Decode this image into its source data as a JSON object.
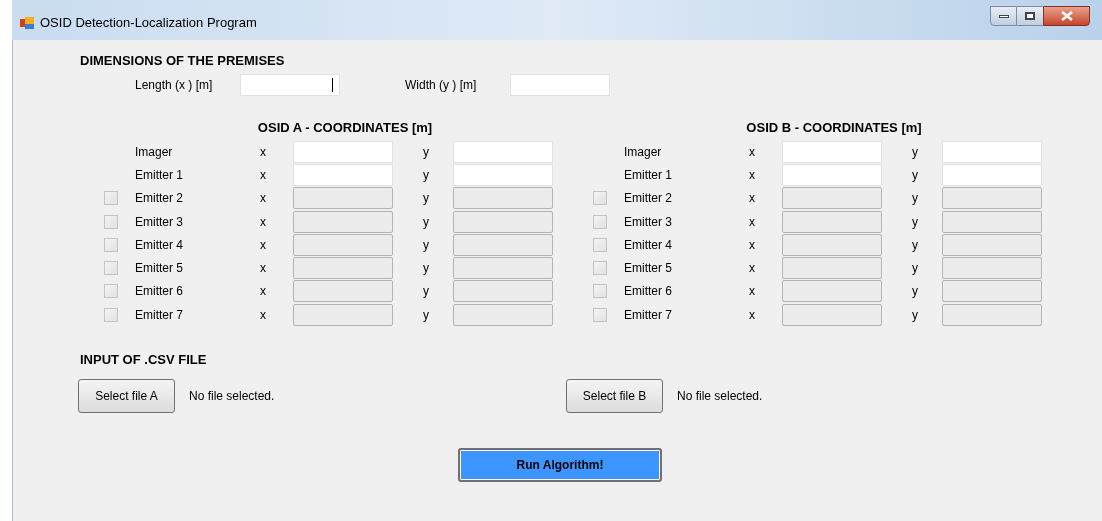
{
  "window": {
    "title": "OSID Detection-Localization Program"
  },
  "dimensions": {
    "heading": "DIMENSIONS OF THE PREMISES",
    "fields": [
      {
        "label": "Length (x ) [m]",
        "focused": true
      },
      {
        "label": "Width (y ) [m]",
        "focused": false
      }
    ]
  },
  "osid_sections": [
    {
      "heading": "OSID A - COORDINATES [m]",
      "rows": [
        {
          "label": "Imager",
          "kind": "fixed",
          "x_label": "x",
          "y_label": "y",
          "disabled": false
        },
        {
          "label": "Emitter 1",
          "kind": "fixed",
          "x_label": "x",
          "y_label": "y",
          "disabled": false
        },
        {
          "label": "Emitter 2",
          "kind": "optional",
          "checked": false,
          "x_label": "x",
          "y_label": "y",
          "disabled": true
        },
        {
          "label": "Emitter 3",
          "kind": "optional",
          "checked": false,
          "x_label": "x",
          "y_label": "y",
          "disabled": true
        },
        {
          "label": "Emitter 4",
          "kind": "optional",
          "checked": false,
          "x_label": "x",
          "y_label": "y",
          "disabled": true
        },
        {
          "label": "Emitter 5",
          "kind": "optional",
          "checked": false,
          "x_label": "x",
          "y_label": "y",
          "disabled": true
        },
        {
          "label": "Emitter 6",
          "kind": "optional",
          "checked": false,
          "x_label": "x",
          "y_label": "y",
          "disabled": true
        },
        {
          "label": "Emitter 7",
          "kind": "optional",
          "checked": false,
          "x_label": "x",
          "y_label": "y",
          "disabled": true
        }
      ]
    },
    {
      "heading": "OSID B - COORDINATES [m]",
      "rows": [
        {
          "label": "Imager",
          "kind": "fixed",
          "x_label": "x",
          "y_label": "y",
          "disabled": false
        },
        {
          "label": "Emitter 1",
          "kind": "fixed",
          "x_label": "x",
          "y_label": "y",
          "disabled": false
        },
        {
          "label": "Emitter 2",
          "kind": "optional",
          "checked": false,
          "x_label": "x",
          "y_label": "y",
          "disabled": true
        },
        {
          "label": "Emitter 3",
          "kind": "optional",
          "checked": false,
          "x_label": "x",
          "y_label": "y",
          "disabled": true
        },
        {
          "label": "Emitter 4",
          "kind": "optional",
          "checked": false,
          "x_label": "x",
          "y_label": "y",
          "disabled": true
        },
        {
          "label": "Emitter 5",
          "kind": "optional",
          "checked": false,
          "x_label": "x",
          "y_label": "y",
          "disabled": true
        },
        {
          "label": "Emitter 6",
          "kind": "optional",
          "checked": false,
          "x_label": "x",
          "y_label": "y",
          "disabled": true
        },
        {
          "label": "Emitter 7",
          "kind": "optional",
          "checked": false,
          "x_label": "x",
          "y_label": "y",
          "disabled": true
        }
      ]
    }
  ],
  "csv": {
    "heading": "INPUT OF .CSV FILE",
    "files": [
      {
        "button": "Select file A",
        "status": "No file selected."
      },
      {
        "button": "Select file B",
        "status": "No file selected."
      }
    ]
  },
  "run_button": "Run Algorithm!"
}
